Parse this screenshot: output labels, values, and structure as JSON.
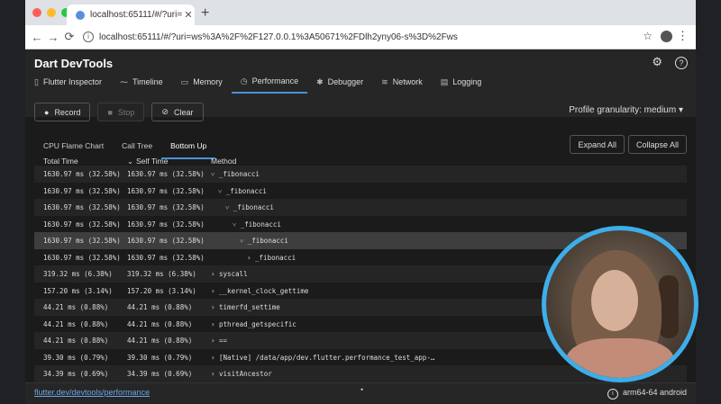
{
  "browser": {
    "tab_title": "localhost:65111/#/?uri=ws%3A",
    "url": "localhost:65111/#/?uri=ws%3A%2F%2F127.0.0.1%3A50671%2FDlh2yny06-s%3D%2Fws"
  },
  "app": {
    "title": "Dart DevTools",
    "nav_tabs": [
      {
        "label": "Flutter Inspector",
        "icon": "phone-icon"
      },
      {
        "label": "Timeline",
        "icon": "timeline-icon"
      },
      {
        "label": "Memory",
        "icon": "memory-icon"
      },
      {
        "label": "Performance",
        "icon": "performance-icon",
        "active": true
      },
      {
        "label": "Debugger",
        "icon": "bug-icon"
      },
      {
        "label": "Network",
        "icon": "network-icon"
      },
      {
        "label": "Logging",
        "icon": "logging-icon"
      }
    ]
  },
  "controls": {
    "record": "Record",
    "stop": "Stop",
    "clear": "Clear",
    "granularity": "Profile granularity: medium"
  },
  "subtabs": [
    "CPU Flame Chart",
    "Call Tree",
    "Bottom Up"
  ],
  "subtab_active": "Bottom Up",
  "expand_all": "Expand All",
  "collapse_all": "Collapse All",
  "columns": {
    "total": "Total Time",
    "self": "Self Time",
    "method": "Method"
  },
  "rows": [
    {
      "total": "1630.97 ms (32.58%)",
      "self": "1630.97 ms (32.58%)",
      "method": "˅ _fibonacci",
      "indent": 0
    },
    {
      "total": "1630.97 ms (32.58%)",
      "self": "1630.97 ms (32.58%)",
      "method": "˅ _fibonacci",
      "indent": 1
    },
    {
      "total": "1630.97 ms (32.58%)",
      "self": "1630.97 ms (32.58%)",
      "method": "˅ _fibonacci",
      "indent": 2
    },
    {
      "total": "1630.97 ms (32.58%)",
      "self": "1630.97 ms (32.58%)",
      "method": "˅ _fibonacci",
      "indent": 3
    },
    {
      "total": "1630.97 ms (32.58%)",
      "self": "1630.97 ms (32.58%)",
      "method": "˅ _fibonacci",
      "indent": 4
    },
    {
      "total": "1630.97 ms (32.58%)",
      "self": "1630.97 ms (32.58%)",
      "method": "› _fibonacci",
      "indent": 5
    },
    {
      "total": "319.32 ms (6.38%)",
      "self": "319.32 ms (6.38%)",
      "method": "› syscall",
      "indent": 0
    },
    {
      "total": "157.20 ms (3.14%)",
      "self": "157.20 ms (3.14%)",
      "method": "› __kernel_clock_gettime",
      "indent": 0
    },
    {
      "total": "44.21 ms (0.88%)",
      "self": "44.21 ms (0.88%)",
      "method": "› timerfd_settime",
      "indent": 0
    },
    {
      "total": "44.21 ms (0.88%)",
      "self": "44.21 ms (0.88%)",
      "method": "› pthread_getspecific",
      "indent": 0
    },
    {
      "total": "44.21 ms (0.88%)",
      "self": "44.21 ms (0.88%)",
      "method": "› ==",
      "indent": 0
    },
    {
      "total": "39.30 ms (0.79%)",
      "self": "39.30 ms (0.79%)",
      "method": "› [Native] /data/app/dev.flutter.performance_test_app-…",
      "indent": 0
    },
    {
      "total": "34.39 ms (0.69%)",
      "self": "34.39 ms (0.69%)",
      "method": "› visitAncestor",
      "indent": 0
    }
  ],
  "footer": {
    "link": "flutter.dev/devtools/performance",
    "dot": "•",
    "device": "arm64-64 android"
  }
}
